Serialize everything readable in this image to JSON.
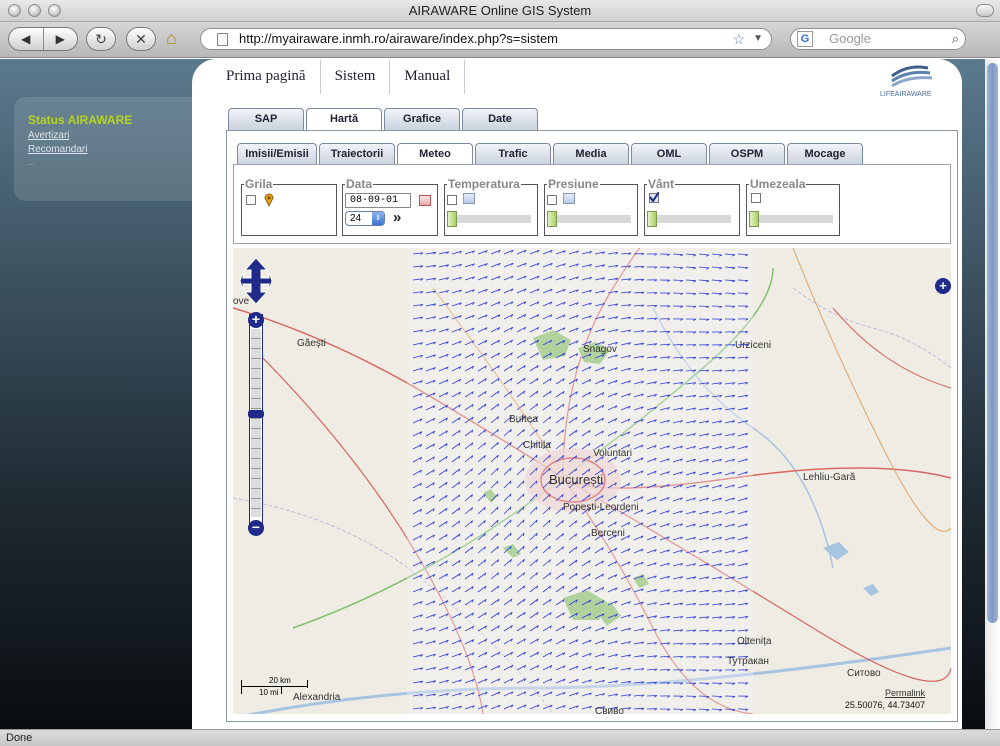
{
  "window": {
    "title": "AIRAWARE Online GIS System"
  },
  "browser": {
    "back_glyph": "◀",
    "forward_glyph": "▶",
    "reload_glyph": "↻",
    "stop_glyph": "✕",
    "url": "http://myairaware.inmh.ro/airaware/index.php?s=sistem",
    "search_placeholder": "Google",
    "search_engine_glyph": "G",
    "status": "Done"
  },
  "sidebar": {
    "title": "Status AIRAWARE",
    "links": [
      "Avertizari",
      "Recomandari"
    ],
    "more": "..."
  },
  "top_menu": [
    "Prima pagină",
    "Sistem",
    "Manual"
  ],
  "logo_text": "LIFEAIRAWARE",
  "main_tabs": [
    {
      "label": "SAP"
    },
    {
      "label": "Hartă",
      "active": true
    },
    {
      "label": "Grafice"
    },
    {
      "label": "Date"
    }
  ],
  "sub_tabs": [
    {
      "label": "Imisii/Emisii"
    },
    {
      "label": "Traiectorii"
    },
    {
      "label": "Meteo",
      "active": true
    },
    {
      "label": "Trafic"
    },
    {
      "label": "Media"
    },
    {
      "label": "OML"
    },
    {
      "label": "OSPM"
    },
    {
      "label": "Mocage"
    }
  ],
  "controls": {
    "grila": {
      "legend": "Grila",
      "checked": false
    },
    "data": {
      "legend": "Data",
      "date_value": "08-09-01",
      "hour_value": "24",
      "next_glyph": "»"
    },
    "temperatura": {
      "legend": "Temperatura",
      "checked": false
    },
    "presiune": {
      "legend": "Presiune",
      "checked": false
    },
    "vant": {
      "legend": "Vânt",
      "checked": true
    },
    "umezeala": {
      "legend": "Umezeala",
      "checked": false
    }
  },
  "map": {
    "places": [
      "Găești",
      "Snagov",
      "Urziceni",
      "Buftea",
      "Chitila",
      "Voluntari",
      "București",
      "Popești-Leordeni",
      "Berceni",
      "Lehliu-Gară",
      "Oltenița",
      "Тутракан",
      "Ситово",
      "Alexandria",
      "Свиво"
    ],
    "scale": {
      "km": "20 km",
      "mi": "10 mi"
    },
    "permalink": "Permalink",
    "coords": "25.50076, 44.73407",
    "zoom_in": "+",
    "zoom_out": "−",
    "layer_switcher": "+",
    "edge_label": "ove",
    "zoom_level_fraction": 0.45,
    "wind_color": "#2b3de0"
  }
}
